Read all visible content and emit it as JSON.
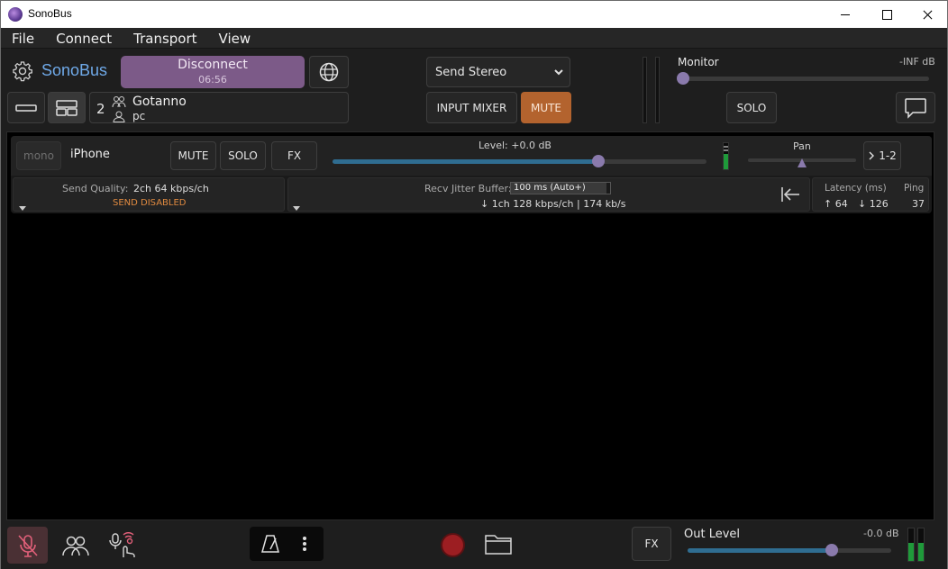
{
  "window": {
    "title": "SonoBus"
  },
  "menu": {
    "items": [
      "File",
      "Connect",
      "Transport",
      "View"
    ]
  },
  "header": {
    "logo": "SonoBus",
    "disconnect_label": "Disconnect",
    "connected_time": "06:56",
    "group": {
      "count": "2",
      "name": "Gotanno",
      "user": "pc"
    },
    "send_mode": "Send Stereo",
    "input_mixer_label": "INPUT MIXER",
    "mute_label": "MUTE",
    "monitor_label": "Monitor",
    "monitor_db": "-INF dB",
    "monitor_level": 0.0,
    "solo_label": "SOLO"
  },
  "peer": {
    "mono_label": "mono",
    "name": "iPhone",
    "mute_label": "MUTE",
    "solo_label": "SOLO",
    "fx_label": "FX",
    "level_label": "Level: +0.0 dB",
    "level_value": 0.71,
    "pan_label": "Pan",
    "pan_value": 0.5,
    "route_label": "1-2",
    "send_quality_label": "Send Quality:",
    "send_quality_value": "2ch 64 kbps/ch",
    "send_status": "SEND DISABLED",
    "jitter_label": "Recv Jitter Buffer:",
    "jitter_value": "100 ms (Auto+)",
    "recv_stats": "↓ 1ch 128 kbps/ch | 174 kb/s",
    "latency_label": "Latency (ms)",
    "ping_label": "Ping",
    "latency_up": "↑ 64",
    "latency_down": "↓ 126",
    "ping_value": "37"
  },
  "footer": {
    "fx_label": "FX",
    "out_level_label": "Out Level",
    "out_level_db": "-0.0 dB",
    "out_level_value": 0.71
  },
  "colors": {
    "accent_purple": "#7c5a88",
    "mute_orange": "#b3632e",
    "slider_blue": "#2f6d91",
    "logo_blue": "#6fa9e8",
    "send_disabled": "#e08a40"
  }
}
